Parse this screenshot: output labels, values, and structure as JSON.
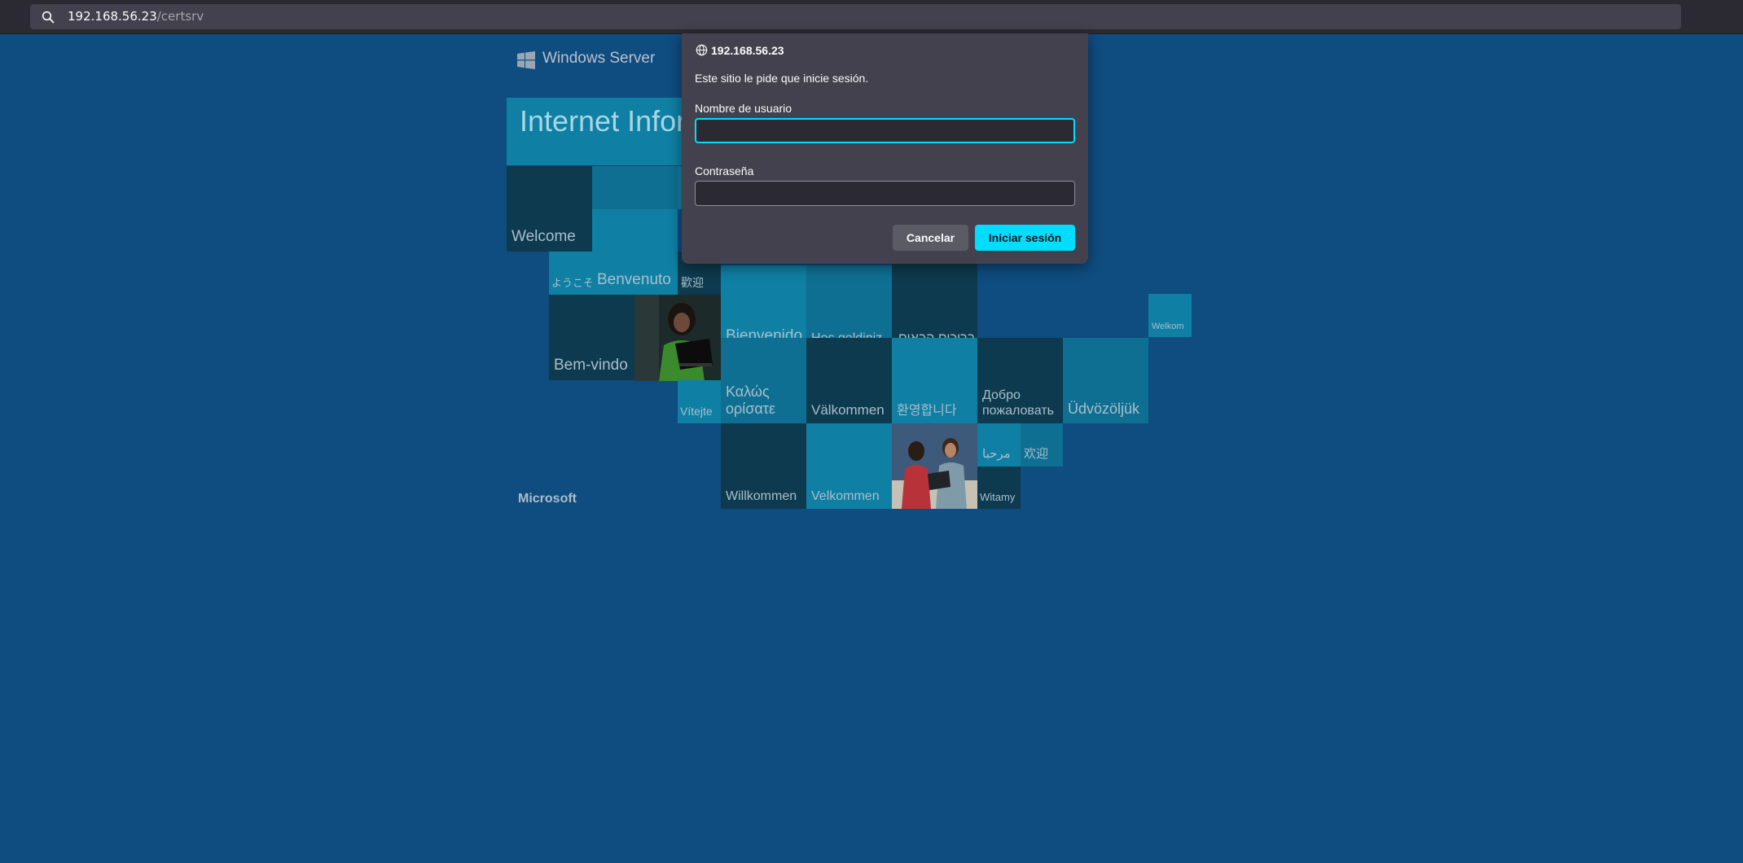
{
  "browser": {
    "url_host": "192.168.56.23",
    "url_path": "/certsrv"
  },
  "iis_page": {
    "product": "Windows Server",
    "banner": "Internet Information Services",
    "footer_brand": "Microsoft",
    "tiles": {
      "welcome": "Welcome",
      "yokoso": "ようこそ",
      "benvenuto": "Benvenuto",
      "huanying_trad": "歡迎",
      "bem_vindo": "Bem-vindo",
      "bienvenido": "Bienvenido",
      "hos_geldiniz": "Hoş geldiniz",
      "bruchim": "ברוכים הבאים",
      "welkom": "Welkom",
      "vitejte": "Vítejte",
      "kalos_1": "Καλώς",
      "kalos_2": "ορίσατε",
      "valkommen": "Välkommen",
      "hwanyeong": "환영합니다",
      "dobro_1": "Добро",
      "dobro_2": "пожаловать",
      "udvozoljuk": "Üdvözöljük",
      "marhaba": "مرحبا",
      "huanying_simp": "欢迎",
      "willkommen": "Willkommen",
      "velkommen": "Velkommen",
      "witamy": "Witamy"
    }
  },
  "auth_dialog": {
    "origin": "192.168.56.23",
    "message": "Este sitio le pide que inicie sesión.",
    "username_label": "Nombre de usuario",
    "username_value": "",
    "password_label": "Contraseña",
    "password_value": "",
    "cancel_label": "Cancelar",
    "login_label": "Iniciar sesión",
    "accent_color": "#00ddff"
  }
}
